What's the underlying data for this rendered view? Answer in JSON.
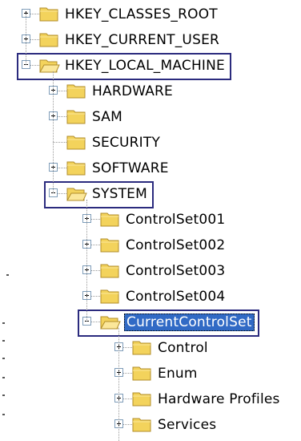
{
  "registry_tree": {
    "root_keys": [
      {
        "label": "HKEY_CLASSES_ROOT",
        "state": "collapsed"
      },
      {
        "label": "HKEY_CURRENT_USER",
        "state": "collapsed"
      },
      {
        "label": "HKEY_LOCAL_MACHINE",
        "state": "expanded",
        "highlighted": true
      }
    ],
    "hklm_children": [
      {
        "label": "HARDWARE",
        "state": "collapsed"
      },
      {
        "label": "SAM",
        "state": "collapsed"
      },
      {
        "label": "SECURITY",
        "state": "leaf"
      },
      {
        "label": "SOFTWARE",
        "state": "collapsed"
      },
      {
        "label": "SYSTEM",
        "state": "expanded",
        "highlighted": true
      }
    ],
    "system_children": [
      {
        "label": "ControlSet001",
        "state": "collapsed"
      },
      {
        "label": "ControlSet002",
        "state": "collapsed"
      },
      {
        "label": "ControlSet003",
        "state": "collapsed"
      },
      {
        "label": "ControlSet004",
        "state": "collapsed"
      },
      {
        "label": "CurrentControlSet",
        "state": "expanded",
        "selected": true,
        "highlighted": true
      }
    ],
    "current_control_set_children": [
      {
        "label": "Control",
        "state": "collapsed"
      },
      {
        "label": "Enum",
        "state": "collapsed"
      },
      {
        "label": "Hardware Profiles",
        "state": "collapsed"
      },
      {
        "label": "Services",
        "state": "collapsed"
      }
    ]
  },
  "colors": {
    "folder_fill": "#f3d35c",
    "folder_stroke": "#b08d2a",
    "selection": "#316ac5",
    "highlight_box": "#2b2b7e"
  },
  "icons": {
    "folder": "folder-icon",
    "open_folder": "open-folder-icon",
    "expand": "plus-box-icon",
    "collapse": "minus-box-icon"
  }
}
